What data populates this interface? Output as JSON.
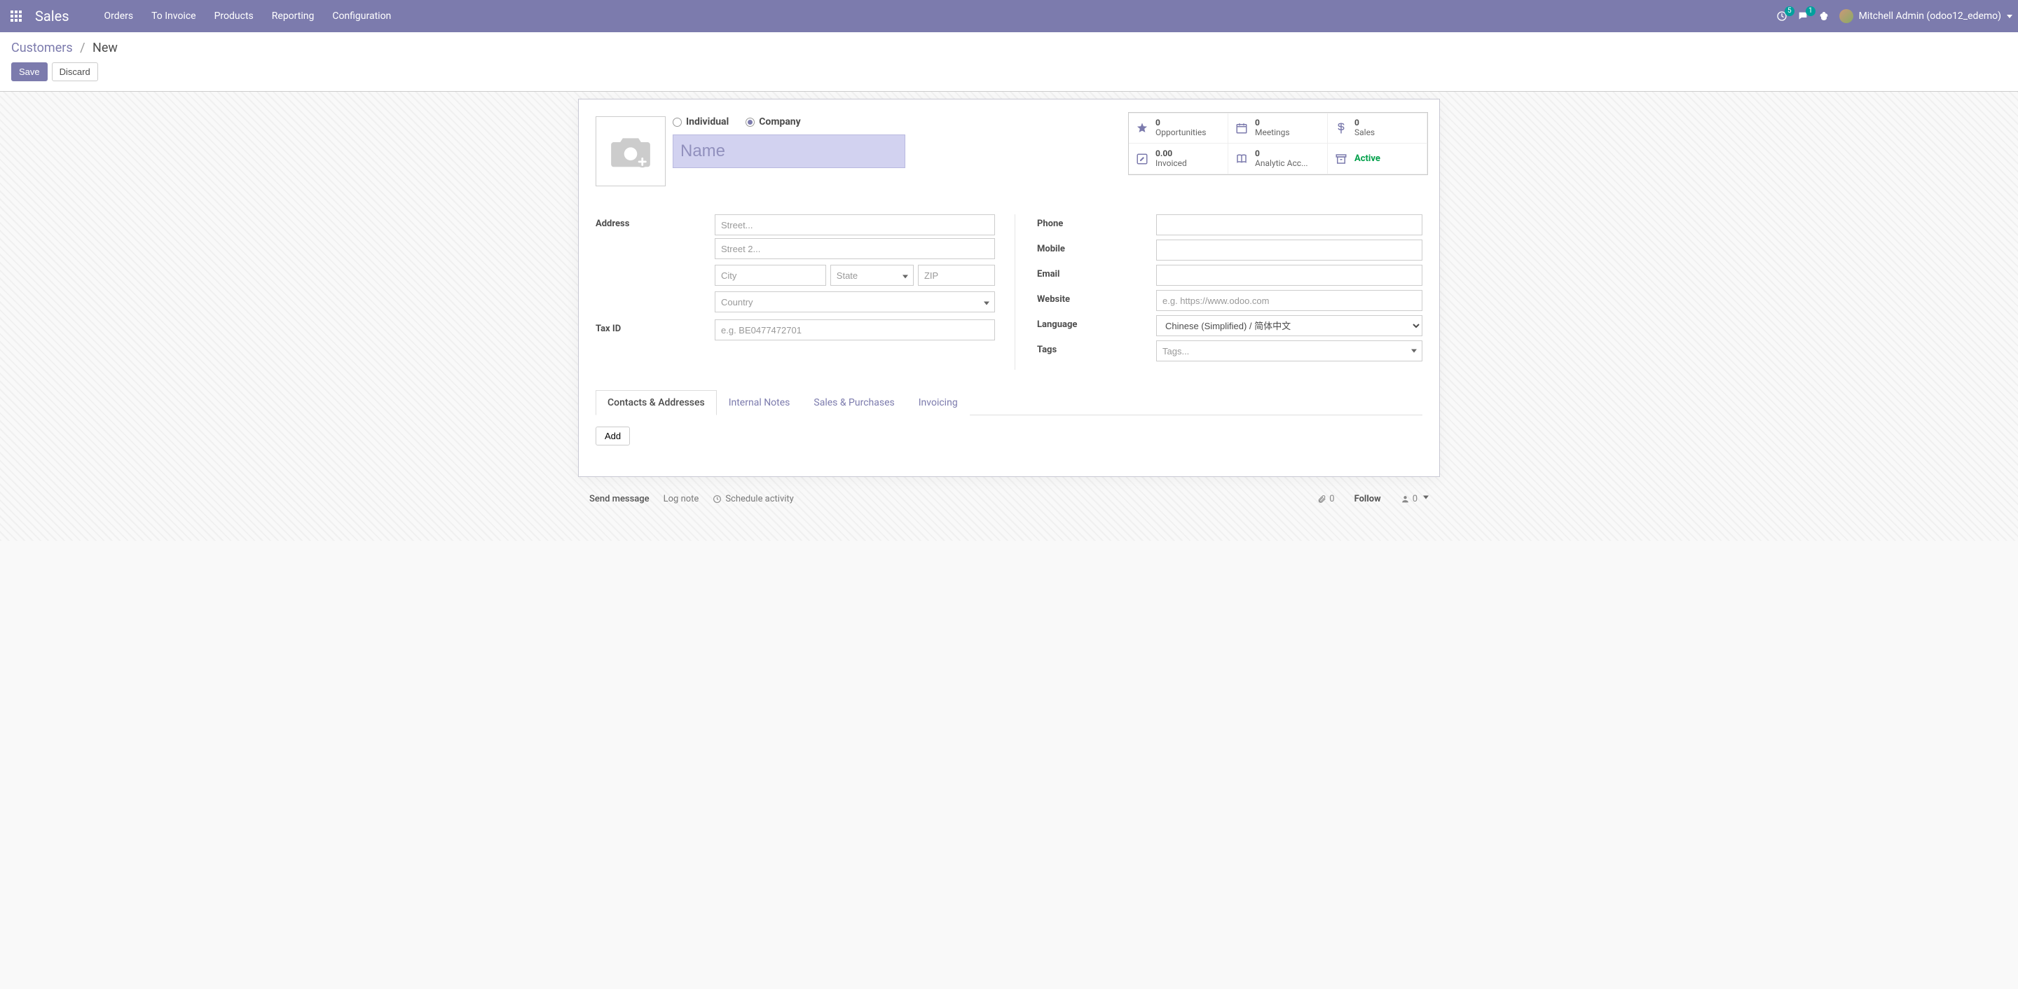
{
  "nav": {
    "brand": "Sales",
    "items": [
      "Orders",
      "To Invoice",
      "Products",
      "Reporting",
      "Configuration"
    ],
    "activities_badge": "5",
    "messages_badge": "1",
    "user": "Mitchell Admin (odoo12_edemo)"
  },
  "breadcrumb": {
    "parent": "Customers",
    "current": "New"
  },
  "buttons": {
    "save": "Save",
    "discard": "Discard"
  },
  "title": {
    "radio_individual": "Individual",
    "radio_company": "Company",
    "name_placeholder": "Name"
  },
  "stats": {
    "opportunities": {
      "val": "0",
      "label": "Opportunities"
    },
    "meetings": {
      "val": "0",
      "label": "Meetings"
    },
    "sales": {
      "val": "0",
      "label": "Sales"
    },
    "invoiced": {
      "val": "0.00",
      "label": "Invoiced"
    },
    "analytic": {
      "val": "0",
      "label": "Analytic Acc..."
    },
    "active": "Active"
  },
  "fields": {
    "address_label": "Address",
    "street_ph": "Street...",
    "street2_ph": "Street 2...",
    "city_ph": "City",
    "state_ph": "State",
    "zip_ph": "ZIP",
    "country_ph": "Country",
    "taxid_label": "Tax ID",
    "taxid_ph": "e.g. BE0477472701",
    "phone_label": "Phone",
    "mobile_label": "Mobile",
    "email_label": "Email",
    "website_label": "Website",
    "website_ph": "e.g. https://www.odoo.com",
    "language_label": "Language",
    "language_value": "Chinese (Simplified) / 简体中文",
    "tags_label": "Tags",
    "tags_ph": "Tags..."
  },
  "tabs": {
    "contacts": "Contacts & Addresses",
    "internal": "Internal Notes",
    "salespurch": "Sales & Purchases",
    "invoicing": "Invoicing",
    "add": "Add"
  },
  "chatter": {
    "send": "Send message",
    "log": "Log note",
    "schedule": "Schedule activity",
    "attach": "0",
    "follow": "Follow",
    "followers": "0"
  }
}
